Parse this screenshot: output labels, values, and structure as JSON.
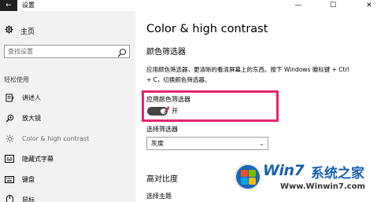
{
  "window": {
    "title": "设置",
    "back_glyph": "←",
    "minimize_glyph": "—",
    "maximize_glyph": "☐",
    "close_glyph": "✕"
  },
  "sidebar": {
    "home_label": "主页",
    "search_placeholder": "查找设置",
    "section_title": "轻松使用",
    "items": [
      {
        "label": "讲述人",
        "icon": "narrator-icon"
      },
      {
        "label": "放大镜",
        "icon": "magnifier-icon"
      },
      {
        "label": "Color & high contrast",
        "icon": "color-contrast-icon",
        "active": true
      },
      {
        "label": "隐藏式字幕",
        "icon": "closed-captions-icon"
      },
      {
        "label": "键盘",
        "icon": "keyboard-icon"
      },
      {
        "label": "鼠标",
        "icon": "mouse-icon"
      }
    ]
  },
  "main": {
    "page_title": "Color & high contrast",
    "color_filter_heading": "颜色筛选器",
    "description": "应用颜色筛选器，更清晰的看清屏幕上的东西。按下 Windows 徽标键 + Ctrl + C，切换颜色筛选器。",
    "toggle_label": "应用颜色筛选器",
    "toggle_state": "开",
    "toggle_on": true,
    "select_label": "选择筛选器",
    "select_value": "灰度",
    "high_contrast_heading": "高对比度",
    "theme_label": "选择主题"
  },
  "colors": {
    "highlight": "#e6246f",
    "sidebar_bg": "#f2f2f2",
    "toggle_on": "#444444"
  },
  "watermark": {
    "brand": "Win7",
    "brand_cn": "系统之家",
    "url": "Www.Winwin7.com"
  }
}
